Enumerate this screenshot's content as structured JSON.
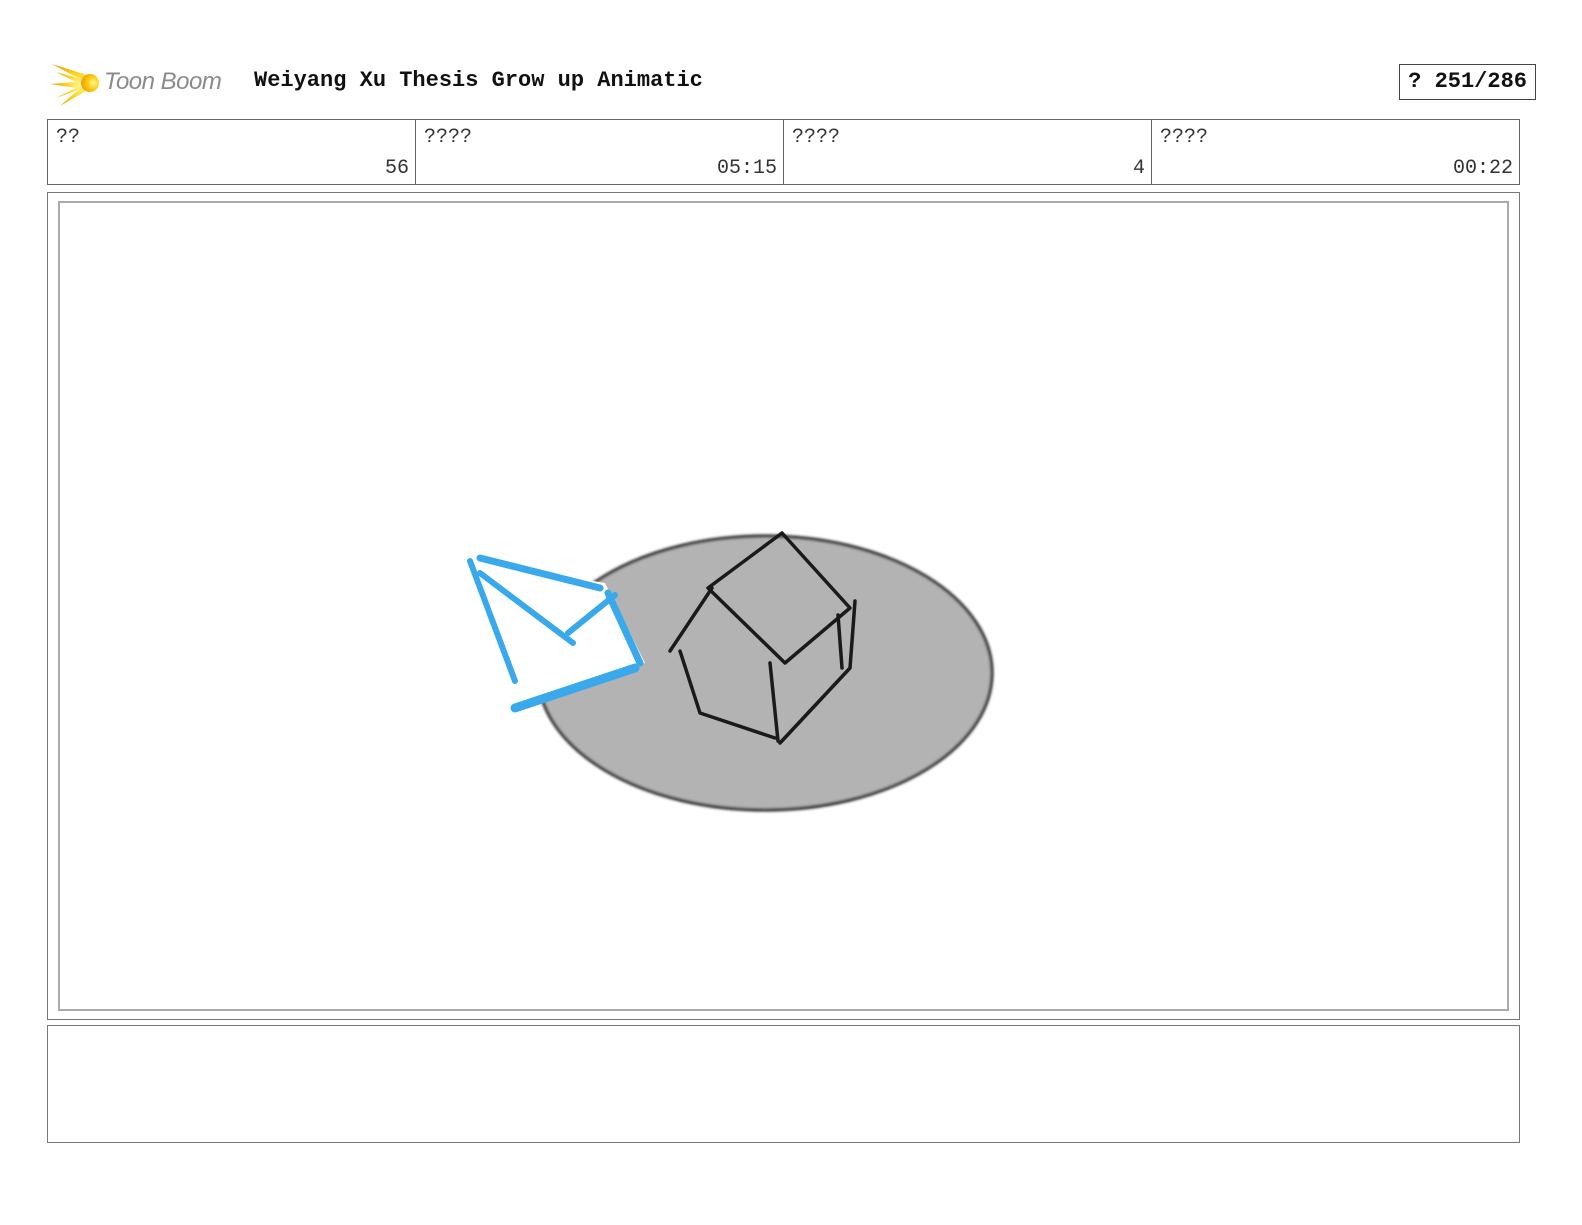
{
  "header": {
    "logo_text": "Toon Boom",
    "logo_icon": "toon-boom-starburst-icon",
    "title": "Weiyang Xu Thesis Grow up Animatic",
    "page_indicator": "? 251/286"
  },
  "info": {
    "cells": [
      {
        "label": "??",
        "value": "56"
      },
      {
        "label": "????",
        "value": "05:15"
      },
      {
        "label": "????",
        "value": "4"
      },
      {
        "label": "????",
        "value": "00:22"
      }
    ]
  },
  "panel": {
    "description_icon": "sketch-house-on-island-with-blue-envelope",
    "colors": {
      "island": "#b3b3b3",
      "ink": "#1a1a1a",
      "envelope": "#39a9ec"
    }
  },
  "notes": {
    "text": ""
  }
}
